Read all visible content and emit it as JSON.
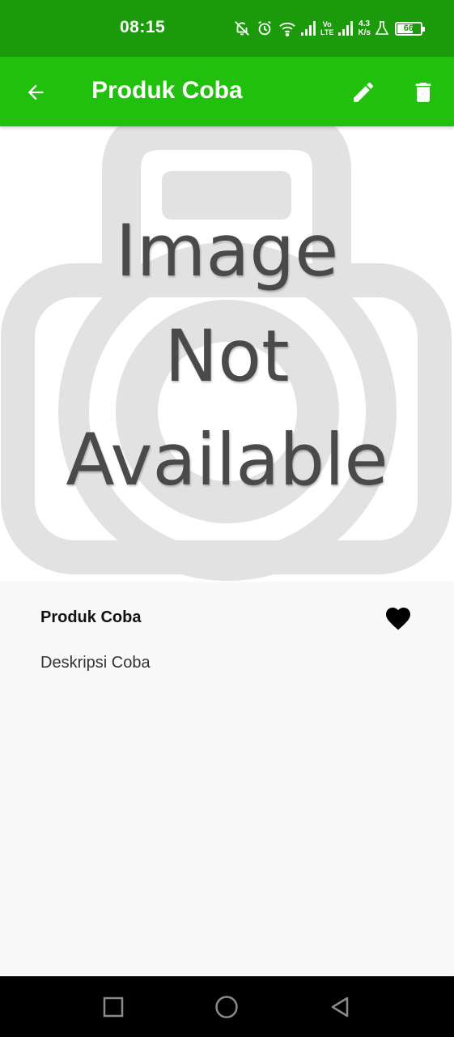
{
  "status_bar": {
    "time": "08:15",
    "volte": [
      "Vo",
      "LTE"
    ],
    "net_speed": [
      "4.3",
      "K/s"
    ],
    "battery": "66",
    "icons": [
      "mute-notification-icon",
      "alarm-icon",
      "wifi-icon",
      "signal-icon",
      "signal-icon",
      "lab-icon"
    ]
  },
  "app_bar": {
    "title": "Produk Coba",
    "back_icon": "arrow-left-icon",
    "edit_icon": "pencil-icon",
    "delete_icon": "trash-icon",
    "color": "#21c00c"
  },
  "image_placeholder": {
    "lines": [
      "Image",
      "Not",
      "Available"
    ]
  },
  "product": {
    "name": "Produk Coba",
    "description": "Deskripsi Coba",
    "favorite_icon": "heart-icon"
  },
  "nav_bar": {
    "icons": [
      "recent-apps-icon",
      "home-icon",
      "back-icon"
    ]
  }
}
